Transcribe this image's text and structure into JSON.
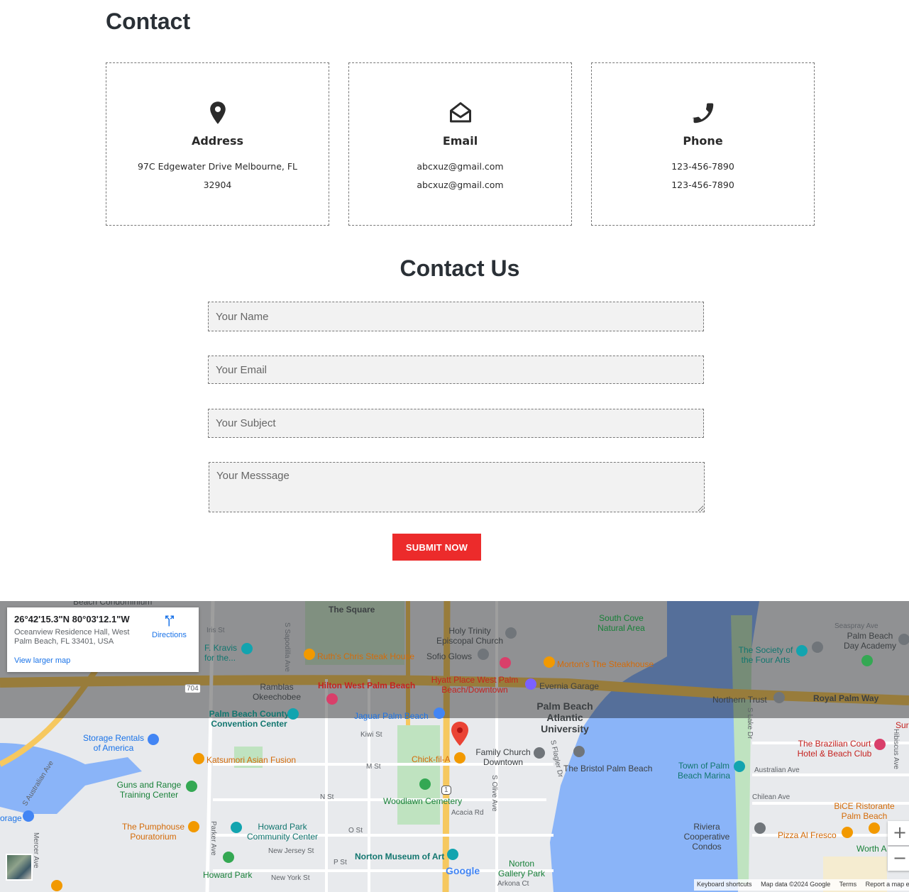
{
  "contact": {
    "title": "Contact",
    "cards": [
      {
        "icon": "map-pin-icon",
        "title": "Address",
        "line1": "97C Edgewater Drive Melbourne, FL",
        "line2": "32904"
      },
      {
        "icon": "envelope-open-icon",
        "title": "Email",
        "line1": "abcxuz@gmail.com",
        "line2": "abcxuz@gmail.com"
      },
      {
        "icon": "phone-icon",
        "title": "Phone",
        "line1": "123-456-7890",
        "line2": "123-456-7890"
      }
    ]
  },
  "form": {
    "title": "Contact Us",
    "name_placeholder": "Your Name",
    "email_placeholder": "Your Email",
    "subject_placeholder": "Your Subject",
    "message_placeholder": "Your Messsage",
    "submit_label": "SUBMIT NOW",
    "submit_color": "#ec2b2b"
  },
  "map": {
    "info": {
      "coords": "26°42'15.3\"N 80°03'12.1\"W",
      "address": "Oceanview Residence Hall, West Palm Beach, FL 33401, USA",
      "larger_map": "View larger map",
      "directions": "Directions"
    },
    "labels": {
      "square": "The Square",
      "holy_trinity": "Holy Trinity Episcopal Church",
      "south_cove": "South Cove Natural Area",
      "seaspray": "Seaspray Ave",
      "pb_day": "Palm Beach Day Academy",
      "iris": "Iris St",
      "kravis": "F. Kravis for the...",
      "sapodilla": "S Sapodilla Ave",
      "ruths": "Ruth's Chris Steak House",
      "sofio": "Sofio Glows",
      "mortons": "Morton's The Steakhouse",
      "society": "The Society of the Four Arts",
      "ramblas": "Ramblas Okeechobee",
      "hilton": "Hilton West Palm Beach",
      "hyatt": "Hyatt Place West Palm Beach/Downtown",
      "evernia": "Evernia Garage",
      "northern": "Northern Trust",
      "royal": "Royal Palm Way",
      "pbcc": "Palm Beach County Convention Center",
      "jaguar": "Jaguar Palm Beach",
      "pba": "Palm Beach Atlantic University",
      "kiwi": "Kiwi St",
      "lake": "S Lake Dr",
      "brazilian": "The Brazilian Court Hotel & Beach Club",
      "storage": "Storage Rentals of America",
      "katsumori": "Katsumori Asian Fusion",
      "m_st": "M St",
      "chickfila": "Chick-fil-A",
      "family": "Family Church Downtown",
      "flagler": "S Flagler Dr",
      "bristol": "The Bristol Palm Beach",
      "town_pb": "Town of Palm Beach Marina",
      "australian": "Australian Ave",
      "s_australian": "S Australian Ave",
      "guns": "Guns and Range Training Center",
      "n_st": "N St",
      "woodlawn": "Woodlawn Cemetery",
      "olive": "S Olive Ave",
      "acacia": "Acacia Rd",
      "chilean": "Chilean Ave",
      "bice": "BiCE Ristorante Palm Beach",
      "storage2": "orage",
      "pumphouse": "The Pumphouse Pouratorium",
      "parker": "Parker Ave",
      "howard": "Howard Park Community Center",
      "o_st": "O St",
      "riviera": "Riviera Cooperative Condos",
      "pizza": "Pizza Al Fresco",
      "worth": "Worth A",
      "mercer": "Mercer Ave",
      "new_jersey": "New Jersey St",
      "norton": "Norton Museum of Art",
      "howard_park": "Howard Park",
      "p_st": "P St",
      "norton_gallery": "Norton Gallery Park",
      "new_york": "New York St",
      "arkona": "Arkona Ct",
      "hibiscus": "Hibiscus Ave",
      "sur": "Sur",
      "beach_condo": "Beach Condominium",
      "okeechobee_route": "704",
      "us1": "1"
    },
    "attribution": {
      "keyboard": "Keyboard shortcuts",
      "data": "Map data ©2024 Google",
      "terms": "Terms",
      "report": "Report a map error"
    },
    "google": "Google",
    "zoom_in": "+",
    "zoom_out": "−"
  }
}
